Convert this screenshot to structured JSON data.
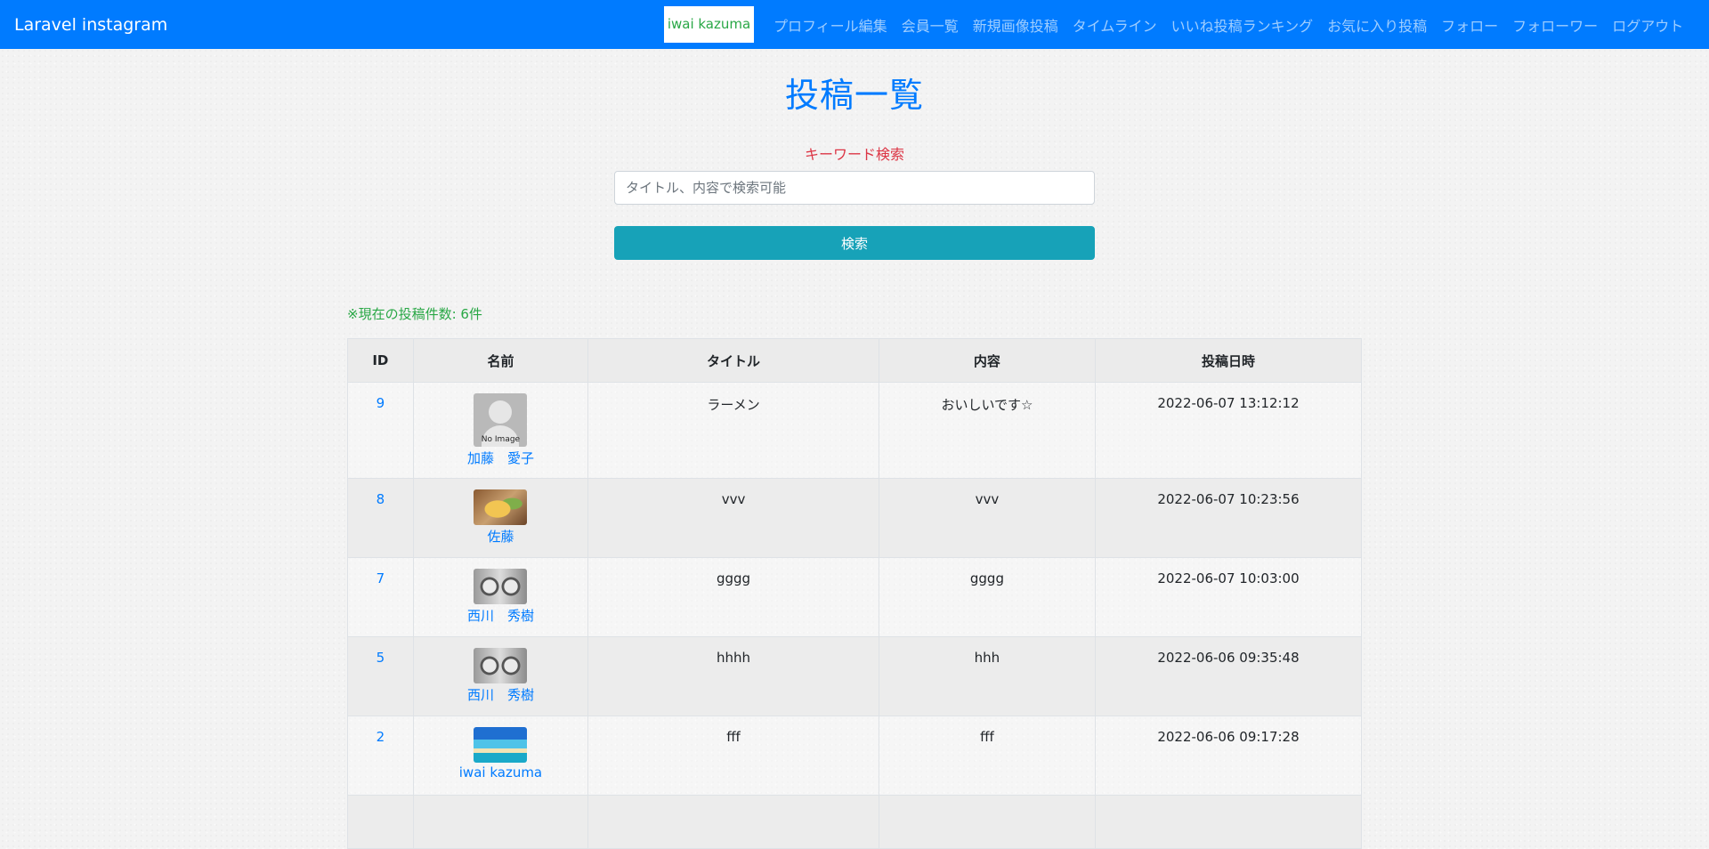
{
  "navbar": {
    "brand": "Laravel instagram",
    "user": "iwai kazuma",
    "links": [
      "プロフィール編集",
      "会員一覧",
      "新規画像投稿",
      "タイムライン",
      "いいね投稿ランキング",
      "お気に入り投稿",
      "フォロー",
      "フォローワー",
      "ログアウト"
    ]
  },
  "main": {
    "title": "投稿一覧",
    "search_label": "キーワード検索",
    "search_placeholder": "タイトル、内容で検索可能",
    "search_button": "検索",
    "count_text": "※現在の投稿件数: 6件"
  },
  "table": {
    "headers": [
      "ID",
      "名前",
      "タイトル",
      "内容",
      "投稿日時"
    ],
    "rows": [
      {
        "id": "9",
        "name": "加藤　愛子",
        "avatar": "no-image",
        "avatar_label": "No Image",
        "title": "ラーメン",
        "content": "おいしいです☆",
        "date": "2022-06-07 13:12:12"
      },
      {
        "id": "8",
        "name": "佐藤",
        "avatar": "food",
        "title": "vvv",
        "content": "vvv",
        "date": "2022-06-07 10:23:56"
      },
      {
        "id": "7",
        "name": "西川　秀樹",
        "avatar": "face",
        "title": "gggg",
        "content": "gggg",
        "date": "2022-06-07 10:03:00"
      },
      {
        "id": "5",
        "name": "西川　秀樹",
        "avatar": "face",
        "title": "hhhh",
        "content": "hhh",
        "date": "2022-06-06 09:35:48"
      },
      {
        "id": "2",
        "name": "iwai kazuma",
        "avatar": "beach",
        "title": "fff",
        "content": "fff",
        "date": "2022-06-06 09:17:28"
      }
    ]
  },
  "colors": {
    "navbar": "#007bff",
    "title": "#007bff",
    "search_label": "#dc3545",
    "search_button": "#17a2b8",
    "count": "#28a745",
    "user_pill_text": "#28a745"
  }
}
